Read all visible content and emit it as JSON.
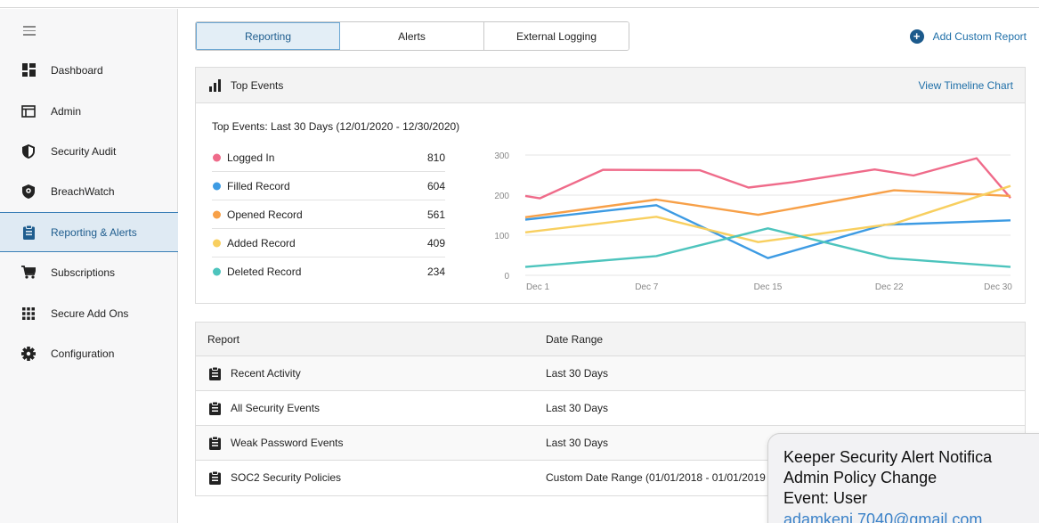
{
  "sidebar": {
    "items": [
      {
        "label": "Dashboard",
        "icon": "dashboard-icon"
      },
      {
        "label": "Admin",
        "icon": "admin-window-icon"
      },
      {
        "label": "Security Audit",
        "icon": "shield-check-icon"
      },
      {
        "label": "BreachWatch",
        "icon": "breachwatch-shield-icon"
      },
      {
        "label": "Reporting & Alerts",
        "icon": "clipboard-icon",
        "active": true
      },
      {
        "label": "Subscriptions",
        "icon": "cart-icon"
      },
      {
        "label": "Secure Add Ons",
        "icon": "grid-icon"
      },
      {
        "label": "Configuration",
        "icon": "gear-icon"
      }
    ]
  },
  "tabs": [
    {
      "label": "Reporting",
      "active": true
    },
    {
      "label": "Alerts"
    },
    {
      "label": "External Logging"
    }
  ],
  "header": {
    "add_custom_report": "Add Custom Report"
  },
  "top_events": {
    "panel_title": "Top Events",
    "view_timeline": "View Timeline Chart",
    "subtitle": "Top Events: Last 30 Days (12/01/2020 - 12/30/2020)",
    "events": [
      {
        "name": "Logged In",
        "count": "810",
        "color": "#ef6b8a"
      },
      {
        "name": "Filled Record",
        "count": "604",
        "color": "#3d9be3"
      },
      {
        "name": "Opened Record",
        "count": "561",
        "color": "#f7a048"
      },
      {
        "name": "Added Record",
        "count": "409",
        "color": "#f8cf5f"
      },
      {
        "name": "Deleted Record",
        "count": "234",
        "color": "#4dc4bd"
      }
    ]
  },
  "chart_data": {
    "type": "line",
    "x": [
      "Dec 1",
      "Dec 4",
      "Dec 7",
      "Dec 9",
      "Dec 12",
      "Dec 15",
      "Dec 18",
      "Dec 22",
      "Dec 24",
      "Dec 28",
      "Dec 30"
    ],
    "xticks": [
      "Dec 1",
      "Dec 7",
      "Dec 15",
      "Dec 22",
      "Dec 30"
    ],
    "ylim": [
      0,
      300
    ],
    "yticks": [
      0,
      100,
      200,
      300
    ],
    "grid": true,
    "series": [
      {
        "name": "Logged In",
        "color": "#ef6b8a",
        "points": [
          [
            0,
            198
          ],
          [
            0.03,
            192
          ],
          [
            0.16,
            263
          ],
          [
            0.36,
            262
          ],
          [
            0.46,
            219
          ],
          [
            0.55,
            232
          ],
          [
            0.72,
            264
          ],
          [
            0.8,
            249
          ],
          [
            0.93,
            292
          ],
          [
            1,
            193
          ]
        ]
      },
      {
        "name": "Filled Record",
        "color": "#3d9be3",
        "points": [
          [
            0,
            139
          ],
          [
            0.27,
            175
          ],
          [
            0.5,
            43
          ],
          [
            0.74,
            126
          ],
          [
            1,
            137
          ]
        ]
      },
      {
        "name": "Opened Record",
        "color": "#f7a048",
        "points": [
          [
            0,
            145
          ],
          [
            0.27,
            189
          ],
          [
            0.48,
            151
          ],
          [
            0.76,
            212
          ],
          [
            1,
            198
          ]
        ]
      },
      {
        "name": "Added Record",
        "color": "#f8cf5f",
        "points": [
          [
            0,
            107
          ],
          [
            0.27,
            146
          ],
          [
            0.48,
            83
          ],
          [
            0.76,
            129
          ],
          [
            1,
            223
          ]
        ]
      },
      {
        "name": "Deleted Record",
        "color": "#4dc4bd",
        "points": [
          [
            0,
            21
          ],
          [
            0.27,
            48
          ],
          [
            0.5,
            117
          ],
          [
            0.75,
            43
          ],
          [
            1,
            21
          ]
        ]
      }
    ]
  },
  "reports": {
    "col_report": "Report",
    "col_range": "Date Range",
    "rows": [
      {
        "name": "Recent Activity",
        "range": "Last 30 Days"
      },
      {
        "name": "All Security Events",
        "range": "Last 30 Days"
      },
      {
        "name": "Weak Password Events",
        "range": "Last 30 Days"
      },
      {
        "name": "SOC2 Security Policies",
        "range": "Custom Date Range (01/01/2018 - 01/01/2019"
      }
    ]
  },
  "notification": {
    "line1": "Keeper Security Alert Notifica",
    "line2": "Admin Policy Change",
    "line3": "Event: User",
    "line4": "adamkeni.7040@gmail.com"
  }
}
